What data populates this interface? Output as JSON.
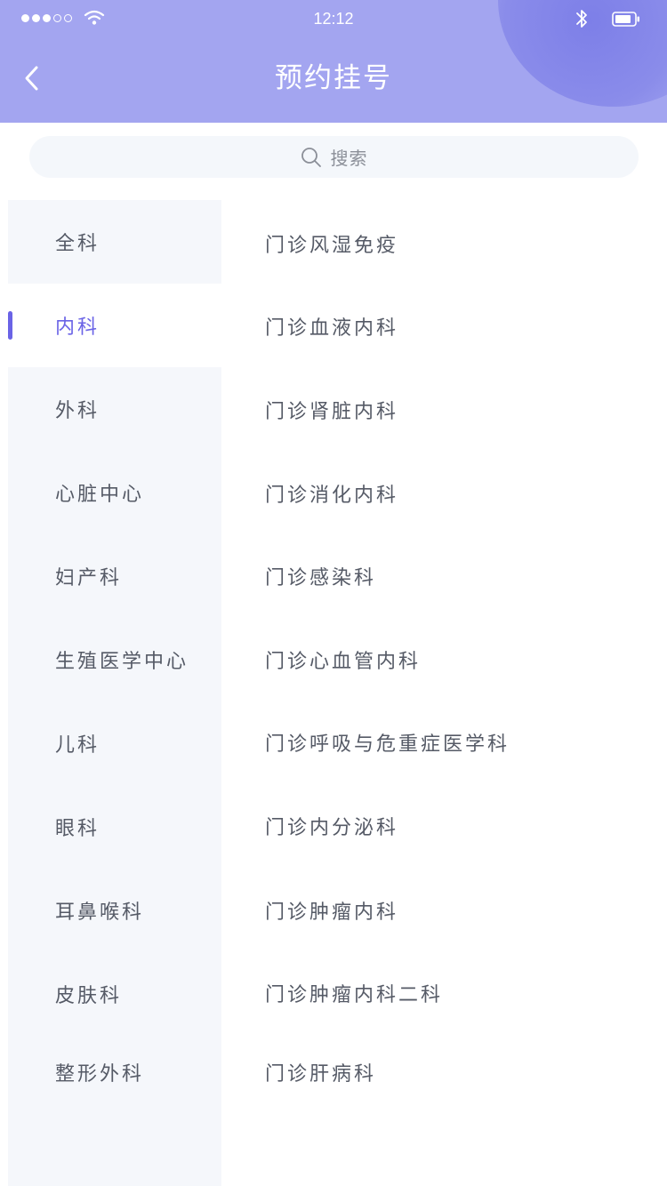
{
  "status_bar": {
    "time": "12:12"
  },
  "header": {
    "title": "预约挂号",
    "background_color": "#a3a5f0",
    "back_icon": "chevron-left-icon"
  },
  "search": {
    "placeholder": "搜索",
    "icon": "search-icon"
  },
  "accent_color": "#6a63e6",
  "sidebar": {
    "selected_index": 1,
    "items": [
      {
        "label": "全科"
      },
      {
        "label": "内科"
      },
      {
        "label": "外科"
      },
      {
        "label": "心脏中心"
      },
      {
        "label": "妇产科"
      },
      {
        "label": "生殖医学中心"
      },
      {
        "label": "儿科"
      },
      {
        "label": "眼科"
      },
      {
        "label": "耳鼻喉科"
      },
      {
        "label": "皮肤科"
      },
      {
        "label": "整形外科"
      }
    ]
  },
  "departments": {
    "items": [
      {
        "label": "门诊风湿免疫"
      },
      {
        "label": "门诊血液内科"
      },
      {
        "label": "门诊肾脏内科"
      },
      {
        "label": "门诊消化内科"
      },
      {
        "label": "门诊感染科"
      },
      {
        "label": "门诊心血管内科"
      },
      {
        "label": "门诊呼吸与危重症医学科"
      },
      {
        "label": "门诊内分泌科"
      },
      {
        "label": "门诊肿瘤内科"
      },
      {
        "label": "门诊肿瘤内科二科"
      },
      {
        "label": "门诊肝病科"
      }
    ]
  }
}
